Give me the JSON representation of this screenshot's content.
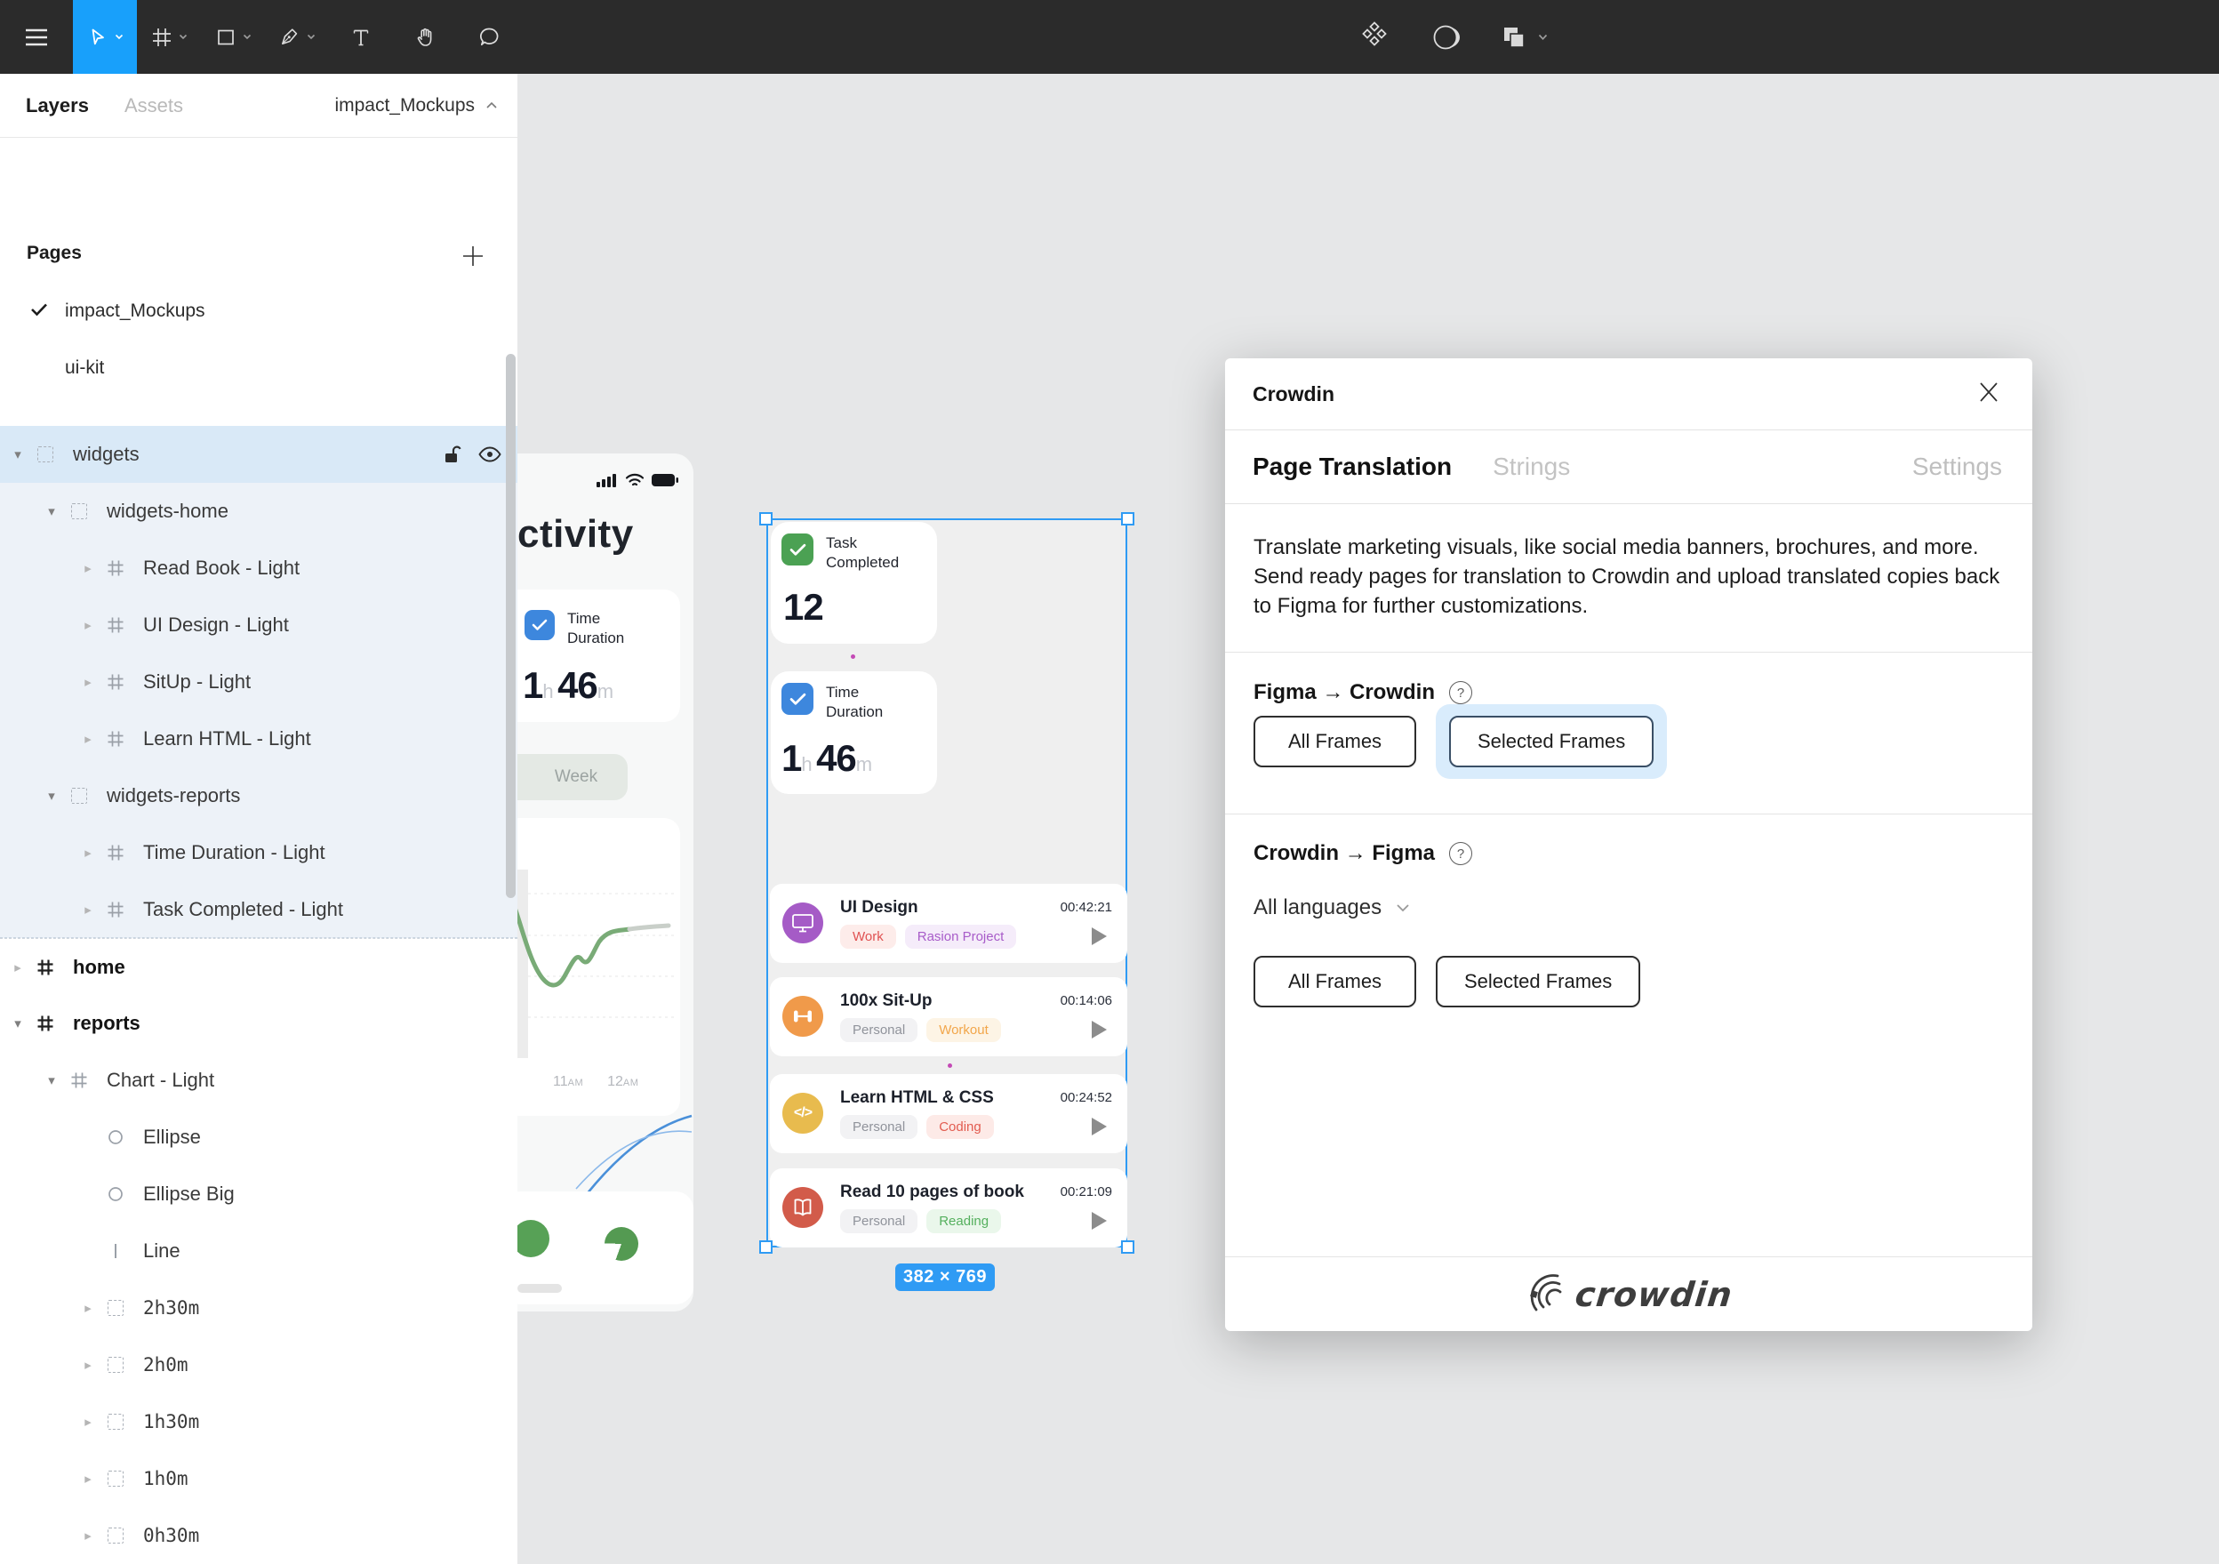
{
  "toolbar": {
    "tools": [
      "menu",
      "move",
      "frame",
      "rectangle",
      "pen",
      "text",
      "hand",
      "comment"
    ],
    "right_tools": [
      "component",
      "mask",
      "boolean"
    ],
    "accent_color": "#18a0fb",
    "background": "#2b2b2b"
  },
  "sidebar": {
    "tabs": {
      "layers": "Layers",
      "assets": "Assets",
      "page_selector": "impact_Mockups"
    },
    "pages": {
      "header": "Pages",
      "items": [
        {
          "label": "impact_Mockups",
          "checked": true
        },
        {
          "label": "ui-kit",
          "checked": false
        }
      ]
    },
    "tree": [
      {
        "label": "widgets",
        "level": 0,
        "icon": "group",
        "chev": "down",
        "selected": true,
        "controls": true
      },
      {
        "label": "widgets-home",
        "level": 1,
        "icon": "group",
        "chev": "down",
        "tinted": true
      },
      {
        "label": "Read Book - Light",
        "level": 2,
        "icon": "frame",
        "chev": "right",
        "tinted": true
      },
      {
        "label": "UI Design - Light",
        "level": 2,
        "icon": "frame",
        "chev": "right",
        "tinted": true
      },
      {
        "label": "SitUp - Light",
        "level": 2,
        "icon": "frame",
        "chev": "right",
        "tinted": true
      },
      {
        "label": "Learn HTML - Light",
        "level": 2,
        "icon": "frame",
        "chev": "right",
        "tinted": true
      },
      {
        "label": "widgets-reports",
        "level": 1,
        "icon": "group",
        "chev": "down",
        "tinted": true
      },
      {
        "label": "Time Duration - Light",
        "level": 2,
        "icon": "frame",
        "chev": "right",
        "tinted": true
      },
      {
        "label": "Task Completed - Light",
        "level": 2,
        "icon": "frame",
        "chev": "right",
        "tinted": true,
        "tintLast": true
      },
      {
        "label": "home",
        "level": 0,
        "icon": "frame",
        "chev": "right",
        "bold": true,
        "dashTop": true
      },
      {
        "label": "reports",
        "level": 0,
        "icon": "frame",
        "chev": "down",
        "bold": true
      },
      {
        "label": "Chart - Light",
        "level": 1,
        "icon": "frame",
        "chev": "down"
      },
      {
        "label": "Ellipse",
        "level": 2,
        "icon": "ellipse",
        "chev": "none"
      },
      {
        "label": "Ellipse Big",
        "level": 2,
        "icon": "ellipse",
        "chev": "none"
      },
      {
        "label": "Line",
        "level": 2,
        "icon": "line",
        "chev": "none"
      },
      {
        "label": "2h30m",
        "level": 2,
        "icon": "group",
        "chev": "right",
        "mono": true
      },
      {
        "label": "2h0m",
        "level": 2,
        "icon": "group",
        "chev": "right",
        "mono": true
      },
      {
        "label": "1h30m",
        "level": 2,
        "icon": "group",
        "chev": "right",
        "mono": true
      },
      {
        "label": "1h0m",
        "level": 2,
        "icon": "group",
        "chev": "right",
        "mono": true
      },
      {
        "label": "0h30m",
        "level": 2,
        "icon": "group",
        "chev": "right",
        "mono": true
      }
    ]
  },
  "canvas": {
    "left_mockup": {
      "title_partial": "ctivity",
      "time_card": {
        "label_line1": "Time",
        "label_line2": "Duration",
        "hours": "1",
        "hours_unit": "h",
        "minutes": "46",
        "minutes_unit": "m",
        "icon_color": "#3d87dd"
      },
      "week_pill": "Week",
      "chart_xlabels": [
        {
          "num": "11",
          "suffix": "AM"
        },
        {
          "num": "12",
          "suffix": "AM"
        }
      ],
      "chart_line_color": "#79ab77"
    },
    "selected_frame": {
      "size_badge": "382 × 769",
      "selection_color": "#2f9bf4",
      "task_completed_card": {
        "label_line1": "Task",
        "label_line2": "Completed",
        "value": "12",
        "icon_color": "#4ba153"
      },
      "time_duration_card": {
        "label_line1": "Time",
        "label_line2": "Duration",
        "hours": "1",
        "hours_unit": "h",
        "minutes": "46",
        "minutes_unit": "m",
        "icon_color": "#3d87dd"
      },
      "tasks": [
        {
          "title": "UI Design",
          "time": "00:42:21",
          "icon": "monitor",
          "circle_color": "#a55bc6",
          "tags": [
            {
              "label": "Work",
              "fg": "#e05252",
              "bg": "#fdecea"
            },
            {
              "label": "Rasion Project",
              "fg": "#a85cc9",
              "bg": "#f5ecfa"
            }
          ]
        },
        {
          "title": "100x Sit-Up",
          "time": "00:14:06",
          "icon": "dumbbell",
          "circle_color": "#f09a4a",
          "tags": [
            {
              "label": "Personal",
              "fg": "#90939b",
              "bg": "#f2f2f4"
            },
            {
              "label": "Workout",
              "fg": "#f2a64a",
              "bg": "#fdf4e5"
            }
          ]
        },
        {
          "title": "Learn HTML & CSS",
          "time": "00:24:52",
          "icon": "code",
          "circle_color": "#e8bb4e",
          "tags": [
            {
              "label": "Personal",
              "fg": "#90939b",
              "bg": "#f2f2f4"
            },
            {
              "label": "Coding",
              "fg": "#e25c50",
              "bg": "#fdeae7"
            }
          ]
        },
        {
          "title": "Read 10 pages of book",
          "time": "00:21:09",
          "icon": "book",
          "circle_color": "#d25b4a",
          "tags": [
            {
              "label": "Personal",
              "fg": "#90939b",
              "bg": "#f2f2f4"
            },
            {
              "label": "Reading",
              "fg": "#55b05e",
              "bg": "#eaf7eb"
            }
          ]
        }
      ]
    }
  },
  "dialog": {
    "title": "Crowdin",
    "tabs": {
      "active": "Page Translation",
      "inactive": "Strings",
      "right": "Settings"
    },
    "description": "Translate marketing visuals, like social media banners, brochures, and more. Send ready pages for translation to Crowdin and upload translated copies back to Figma for further customizations.",
    "figma_to_crowdin": {
      "heading": "Figma → Crowdin",
      "all_frames": "All Frames",
      "selected_frames": "Selected Frames",
      "selected_option": "Selected Frames"
    },
    "crowdin_to_figma": {
      "heading": "Crowdin → Figma",
      "language_selector": "All languages",
      "all_frames": "All Frames",
      "selected_frames": "Selected Frames"
    },
    "logo_text": "crowdin"
  }
}
